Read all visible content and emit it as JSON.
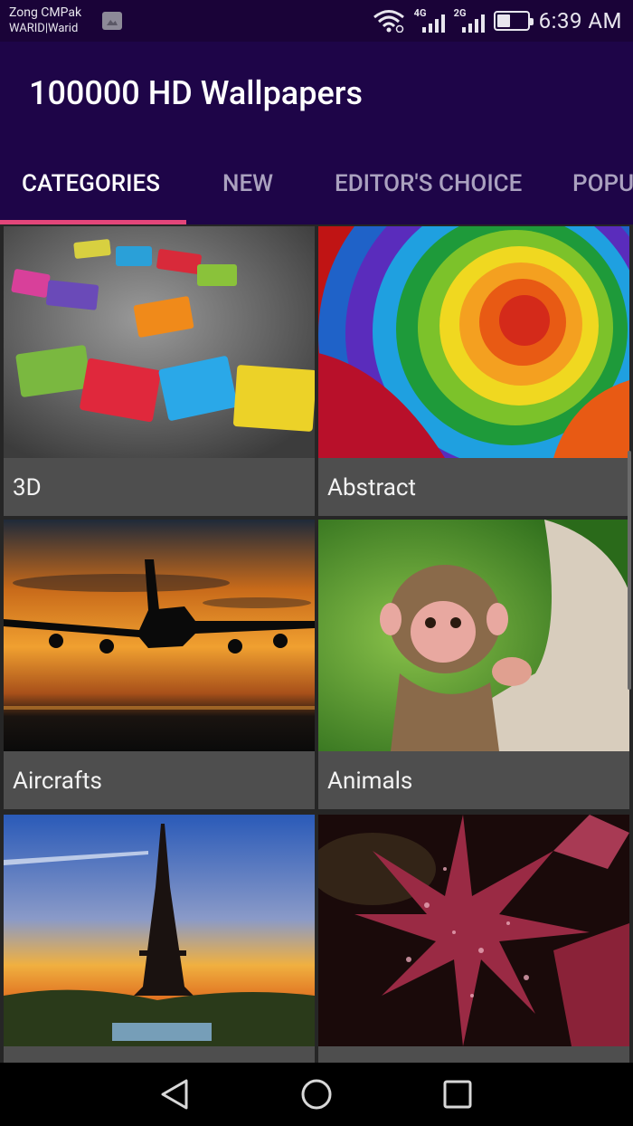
{
  "status_bar": {
    "carrier_line1": "Zong CMPak",
    "carrier_line2": "WARID|Warid",
    "notification_icon": "image-icon",
    "wifi_icon": "wifi-icon",
    "network_1": "4G",
    "network_2": "2G",
    "battery_level": 0.45,
    "time": "6:39 AM"
  },
  "app_bar": {
    "title": "100000 HD Wallpapers"
  },
  "tabs": [
    {
      "label": "CATEGORIES",
      "active": true
    },
    {
      "label": "NEW",
      "active": false
    },
    {
      "label": "EDITOR'S CHOICE",
      "active": false
    },
    {
      "label": "POPU",
      "active": false
    }
  ],
  "categories": [
    {
      "label": "3D"
    },
    {
      "label": "Abstract"
    },
    {
      "label": "Aircrafts"
    },
    {
      "label": "Animals"
    },
    {
      "label": ""
    },
    {
      "label": ""
    }
  ],
  "nav_bar": {
    "back_icon": "back-triangle-icon",
    "home_icon": "home-circle-icon",
    "recents_icon": "recents-square-icon"
  },
  "colors": {
    "app_bar": "#1e0548",
    "tab_indicator": "#e3467a",
    "card_label_bg": "#4e4e4e"
  }
}
